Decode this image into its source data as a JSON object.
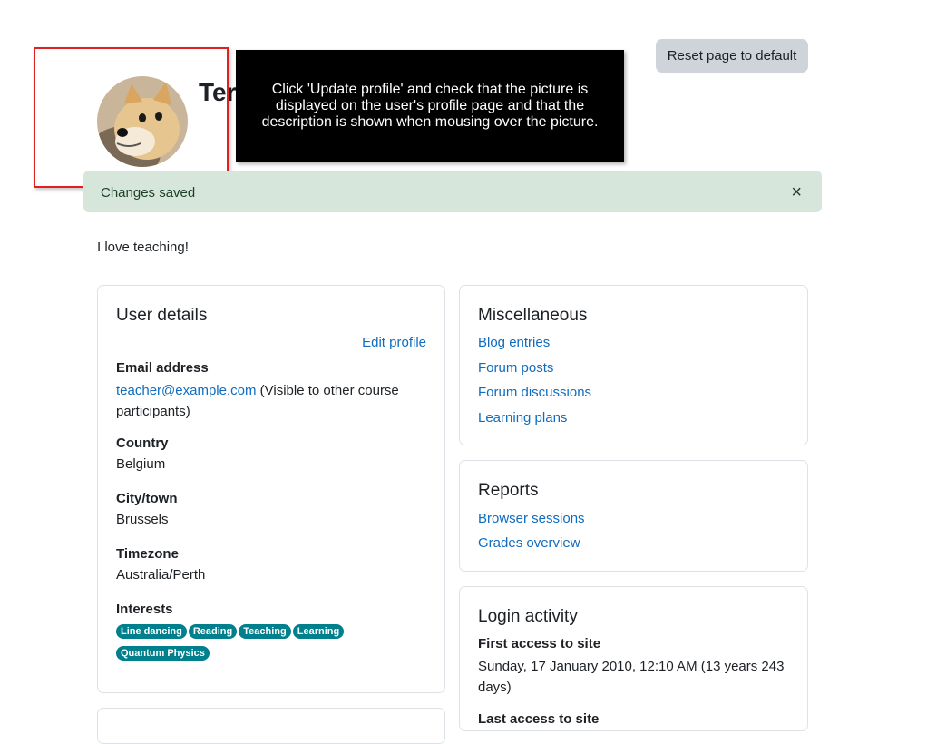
{
  "header": {
    "reset_label": "Reset page to default",
    "user_name": "Ter"
  },
  "tour": {
    "text": "Click 'Update profile' and check that the picture is displayed on the user's profile page and that the description is shown when mousing over the picture."
  },
  "alert": {
    "text": "Changes saved",
    "close": "×"
  },
  "description": "I love teaching!",
  "user_details": {
    "title": "User details",
    "edit_label": "Edit profile",
    "email_label": "Email address",
    "email": "teacher@example.com",
    "email_note": "(Visible to other course",
    "email_note2": "participants)",
    "country_label": "Country",
    "country": "Belgium",
    "city_label": "City/town",
    "city": "Brussels",
    "timezone_label": "Timezone",
    "timezone": "Australia/Perth",
    "interests_label": "Interests",
    "interests": [
      "Line dancing",
      "Reading",
      "Teaching",
      "Learning",
      "Quantum Physics"
    ]
  },
  "misc": {
    "title": "Miscellaneous",
    "links": [
      "Blog entries",
      "Forum posts",
      "Forum discussions",
      "Learning plans"
    ]
  },
  "reports": {
    "title": "Reports",
    "links": [
      "Browser sessions",
      "Grades overview"
    ]
  },
  "login": {
    "title": "Login activity",
    "first_label": "First access to site",
    "first_value": "Sunday, 17 January 2010, 12:10 AM  (13 years 243",
    "first_value2": "days)",
    "last_label": "Last access to site"
  },
  "colors": {
    "link": "#0f6cbf",
    "tag": "#007f8c",
    "alert_bg": "#d7e6da",
    "highlight": "#e02020"
  }
}
